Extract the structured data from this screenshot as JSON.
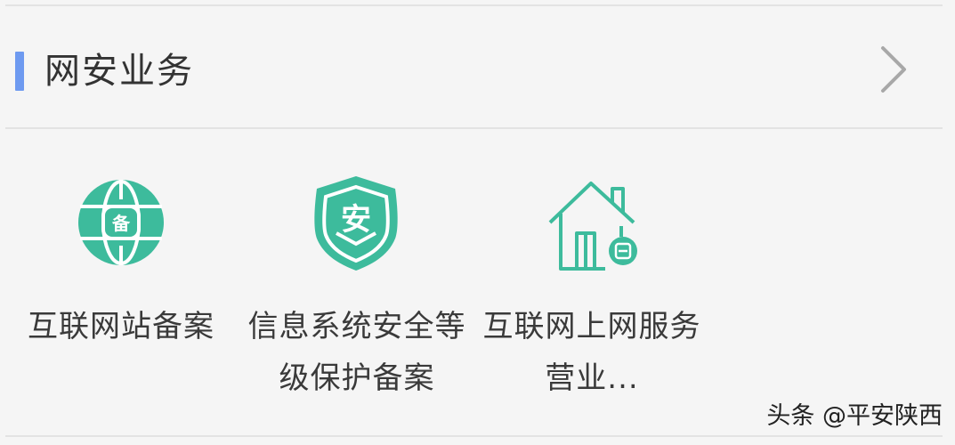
{
  "section": {
    "title": "网安业务",
    "accent_color": "#6e9af0",
    "more_icon": "chevron-right-icon"
  },
  "services": [
    {
      "label": "互联网站备案",
      "icon": "globe-registration-icon"
    },
    {
      "label": "信息系统安全等级保护备案",
      "icon": "security-shield-icon"
    },
    {
      "label": "互联网上网服务营业...",
      "icon": "house-business-icon"
    }
  ],
  "icon_color": "#3dbb9c",
  "watermark": "头条 @平安陕西"
}
